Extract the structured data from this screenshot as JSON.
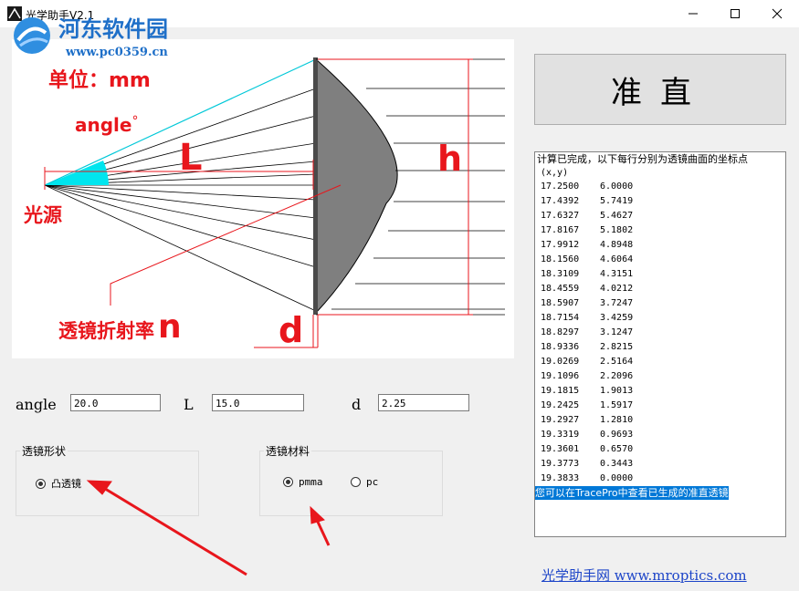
{
  "window": {
    "title": "光学助手V2.1"
  },
  "watermark": {
    "name": "河东软件园",
    "url": "www.pc0359.cn"
  },
  "diagram": {
    "unit_label": "单位：mm",
    "angle_label": "angle",
    "angle_symbol": "°",
    "L_label": "L",
    "h_label": "h",
    "source_label": "光源",
    "n_text": "透镜折射率",
    "n_label": "n",
    "d_label": "d"
  },
  "inputs": {
    "angle": {
      "label": "angle",
      "value": "20.0"
    },
    "L": {
      "label": "L",
      "value": "15.0"
    },
    "d": {
      "label": "d",
      "value": "2.25"
    }
  },
  "shape_group": {
    "title": "透镜形状",
    "options": [
      {
        "label": "凸透镜",
        "checked": true
      }
    ]
  },
  "material_group": {
    "title": "透镜材料",
    "options": [
      {
        "label": "pmma",
        "checked": true
      },
      {
        "label": "pc",
        "checked": false
      }
    ]
  },
  "collimate_button": {
    "label": "准直"
  },
  "output": {
    "header": "计算已完成，以下每行分别为透镜曲面的坐标点",
    "subheader": "(x,y)",
    "rows": [
      [
        "17.2500",
        "6.0000"
      ],
      [
        "17.4392",
        "5.7419"
      ],
      [
        "17.6327",
        "5.4627"
      ],
      [
        "17.8167",
        "5.1802"
      ],
      [
        "17.9912",
        "4.8948"
      ],
      [
        "18.1560",
        "4.6064"
      ],
      [
        "18.3109",
        "4.3151"
      ],
      [
        "18.4559",
        "4.0212"
      ],
      [
        "18.5907",
        "3.7247"
      ],
      [
        "18.7154",
        "3.4259"
      ],
      [
        "18.8297",
        "3.1247"
      ],
      [
        "18.9336",
        "2.8215"
      ],
      [
        "19.0269",
        "2.5164"
      ],
      [
        "19.1096",
        "2.2096"
      ],
      [
        "19.1815",
        "1.9013"
      ],
      [
        "19.2425",
        "1.5917"
      ],
      [
        "19.2927",
        "1.2810"
      ],
      [
        "19.3319",
        "0.9693"
      ],
      [
        "19.3601",
        "0.6570"
      ],
      [
        "19.3773",
        "0.3443"
      ],
      [
        "19.3833",
        "0.0000"
      ]
    ],
    "footer": "您可以在TracePro中查看已生成的准直透镜"
  },
  "footer_link": {
    "text": "光学助手网 www.mroptics.com"
  },
  "colors": {
    "annotation_red": "#e8161c",
    "beam_cyan": "#00e5ee",
    "link_blue": "#1c44c8",
    "selection_blue": "#0078d7"
  }
}
